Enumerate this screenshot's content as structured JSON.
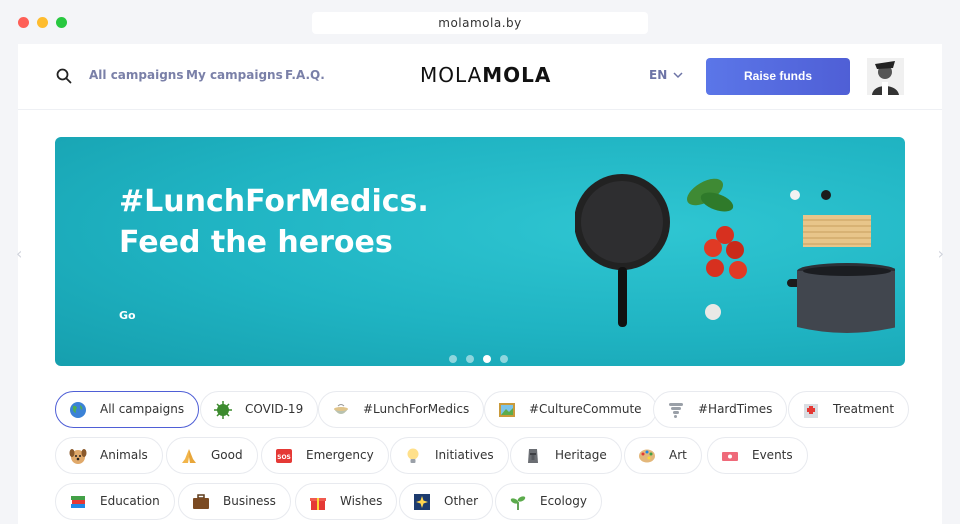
{
  "browser": {
    "url": "molamola.by"
  },
  "header": {
    "nav": [
      "All campaigns",
      "My campaigns",
      "F.A.Q."
    ],
    "logo_thin": "MOLA",
    "logo_bold": "MOLA",
    "language": "EN",
    "raise_button": "Raise funds"
  },
  "banner": {
    "title_line1": "#LunchForMedics.",
    "title_line2": "Feed the heroes",
    "cta": "Go",
    "slides_total": 4,
    "active_slide": 3
  },
  "tags": [
    {
      "label": "All campaigns",
      "icon": "globe-icon",
      "active": true
    },
    {
      "label": "COVID-19",
      "icon": "virus-icon"
    },
    {
      "label": "#LunchForMedics",
      "icon": "bowl-icon"
    },
    {
      "label": "#CultureCommute",
      "icon": "painting-icon"
    },
    {
      "label": "#HardTimes",
      "icon": "tornado-icon"
    },
    {
      "label": "Treatment",
      "icon": "hospital-icon"
    },
    {
      "label": "Animals",
      "icon": "dog-icon"
    },
    {
      "label": "Good",
      "icon": "praying-hands-icon"
    },
    {
      "label": "Emergency",
      "icon": "sos-icon"
    },
    {
      "label": "Initiatives",
      "icon": "lightbulb-icon"
    },
    {
      "label": "Heritage",
      "icon": "moai-icon"
    },
    {
      "label": "Art",
      "icon": "palette-icon"
    },
    {
      "label": "Events",
      "icon": "ticket-icon"
    },
    {
      "label": "Education",
      "icon": "books-icon"
    },
    {
      "label": "Business",
      "icon": "briefcase-icon"
    },
    {
      "label": "Wishes",
      "icon": "gift-icon"
    },
    {
      "label": "Other",
      "icon": "sparkle-icon"
    },
    {
      "label": "Ecology",
      "icon": "seedling-icon"
    }
  ]
}
